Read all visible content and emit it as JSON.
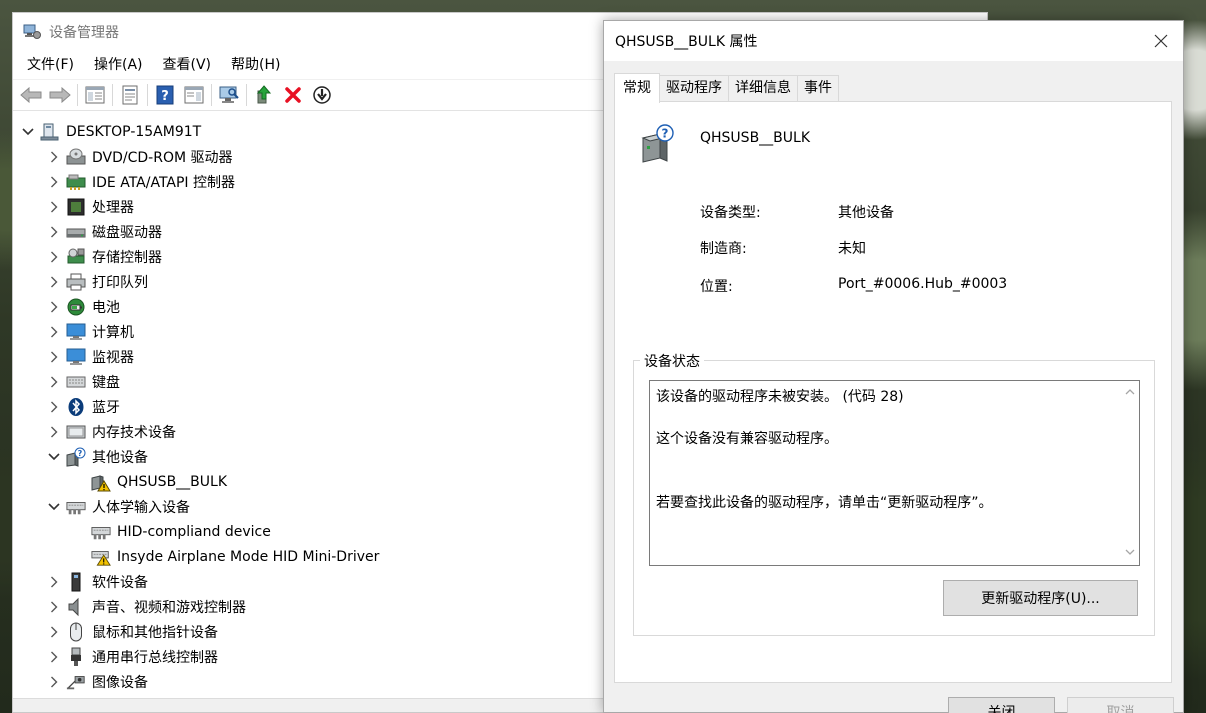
{
  "device_manager": {
    "title": "设备管理器",
    "menu": [
      "文件(F)",
      "操作(A)",
      "查看(V)",
      "帮助(H)"
    ],
    "tree": {
      "root": "DESKTOP-15AM91T",
      "items": [
        {
          "label": "DVD/CD-ROM 驱动器",
          "icon": "dvd-drive-icon",
          "expanded": false,
          "depth": 1
        },
        {
          "label": "IDE ATA/ATAPI 控制器",
          "icon": "ide-controller-icon",
          "expanded": false,
          "depth": 1
        },
        {
          "label": "处理器",
          "icon": "processor-icon",
          "expanded": false,
          "depth": 1
        },
        {
          "label": "磁盘驱动器",
          "icon": "disk-drive-icon",
          "expanded": false,
          "depth": 1
        },
        {
          "label": "存储控制器",
          "icon": "storage-controller-icon",
          "expanded": false,
          "depth": 1
        },
        {
          "label": "打印队列",
          "icon": "printer-icon",
          "expanded": false,
          "depth": 1
        },
        {
          "label": "电池",
          "icon": "battery-icon",
          "expanded": false,
          "depth": 1
        },
        {
          "label": "计算机",
          "icon": "computer-icon",
          "expanded": false,
          "depth": 1
        },
        {
          "label": "监视器",
          "icon": "monitor-icon",
          "expanded": false,
          "depth": 1
        },
        {
          "label": "键盘",
          "icon": "keyboard-icon",
          "expanded": false,
          "depth": 1
        },
        {
          "label": "蓝牙",
          "icon": "bluetooth-icon",
          "expanded": false,
          "depth": 1
        },
        {
          "label": "内存技术设备",
          "icon": "memory-device-icon",
          "expanded": false,
          "depth": 1
        },
        {
          "label": "其他设备",
          "icon": "other-devices-icon",
          "expanded": true,
          "depth": 1
        },
        {
          "label": "QHSUSB__BULK",
          "icon": "warning-device-icon",
          "expanded": null,
          "depth": 2
        },
        {
          "label": "人体学输入设备",
          "icon": "hid-icon",
          "expanded": true,
          "depth": 1
        },
        {
          "label": "HID-compliand device",
          "icon": "hid-icon",
          "expanded": null,
          "depth": 2
        },
        {
          "label": "Insyde Airplane Mode HID Mini-Driver",
          "icon": "warning-hid-icon",
          "expanded": null,
          "depth": 2
        },
        {
          "label": "软件设备",
          "icon": "software-device-icon",
          "expanded": false,
          "depth": 1
        },
        {
          "label": "声音、视频和游戏控制器",
          "icon": "speaker-icon",
          "expanded": false,
          "depth": 1
        },
        {
          "label": "鼠标和其他指针设备",
          "icon": "mouse-icon",
          "expanded": false,
          "depth": 1
        },
        {
          "label": "通用串行总线控制器",
          "icon": "usb-icon",
          "expanded": false,
          "depth": 1
        },
        {
          "label": "图像设备",
          "icon": "camera-icon",
          "expanded": false,
          "depth": 1
        }
      ]
    }
  },
  "properties_dialog": {
    "title": "QHSUSB__BULK 属性",
    "tabs": [
      "常规",
      "驱动程序",
      "详细信息",
      "事件"
    ],
    "active_tab": 0,
    "device_name": "QHSUSB__BULK",
    "properties": [
      {
        "label": "设备类型:",
        "value": "其他设备"
      },
      {
        "label": "制造商:",
        "value": "未知"
      },
      {
        "label": "位置:",
        "value": "Port_#0006.Hub_#0003"
      }
    ],
    "status_group_label": "设备状态",
    "status_lines": [
      "该设备的驱动程序未被安装。 (代码 28)",
      "这个设备没有兼容驱动程序。",
      "若要查找此设备的驱动程序，请单击“更新驱动程序”。"
    ],
    "update_driver_button": "更新驱动程序(U)...",
    "ok_button": "关闭",
    "cancel_button": "取消"
  },
  "colors": {
    "warning": "#f2c200",
    "error_red": "#e81123",
    "accent_blue": "#1e5fb4"
  }
}
